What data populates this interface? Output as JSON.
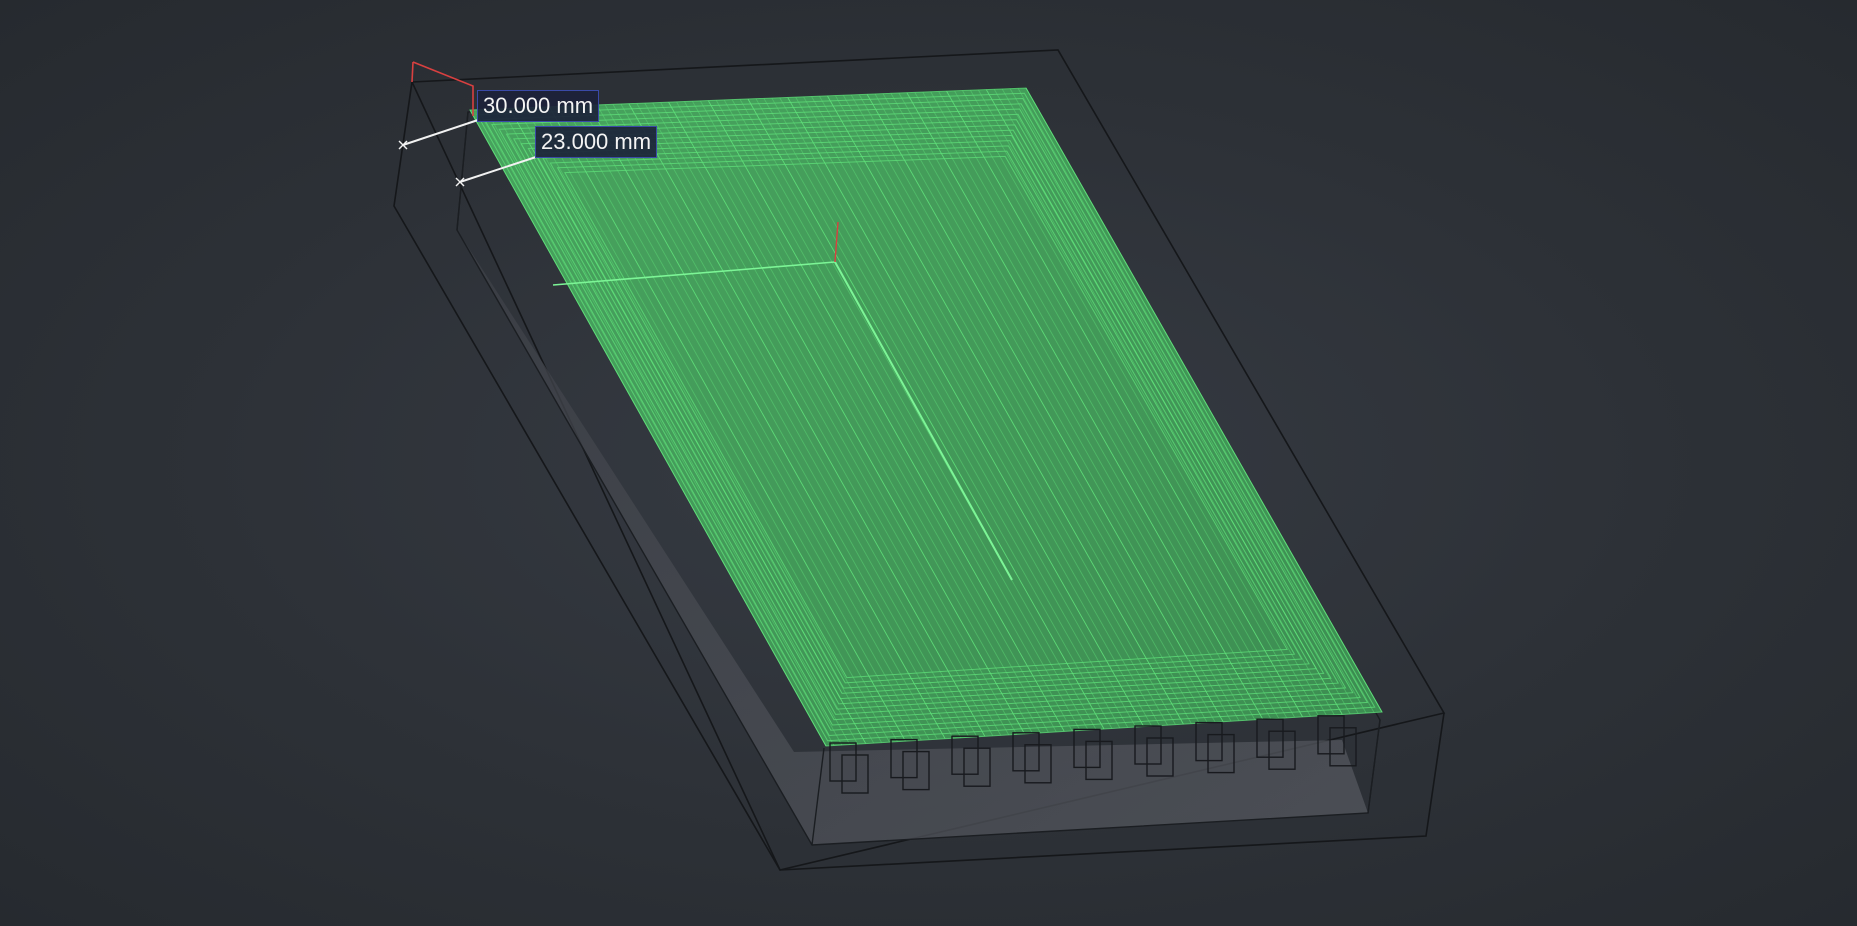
{
  "viewport": {
    "background": "#2b2f35",
    "toolpath_color": "#5fe07a",
    "stock_edge_color": "#141619",
    "part_edge_color": "#1b1e22",
    "axis_x_color": "#e04040"
  },
  "dimensions": {
    "primary": "30.000 mm",
    "secondary": "23.000 mm"
  }
}
